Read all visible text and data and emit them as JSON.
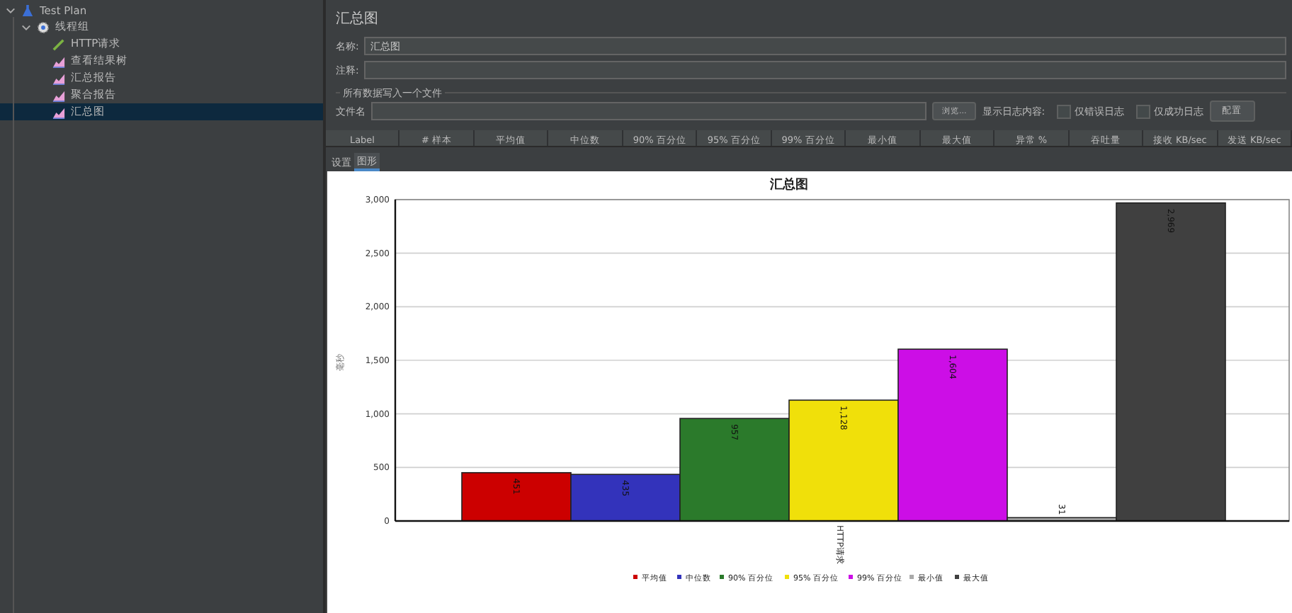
{
  "tree": [
    {
      "label": "Test Plan",
      "kind": "plan",
      "expanded": true,
      "selected": false,
      "children": [
        {
          "label": "线程组",
          "kind": "threads",
          "expanded": true,
          "selected": false,
          "children": [
            {
              "label": "HTTP请求",
              "kind": "sampler",
              "selected": false
            },
            {
              "label": "查看结果树",
              "kind": "listener",
              "selected": false
            },
            {
              "label": "汇总报告",
              "kind": "listener",
              "selected": false
            },
            {
              "label": "聚合报告",
              "kind": "listener",
              "selected": false
            },
            {
              "label": "汇总图",
              "kind": "listener",
              "selected": true
            }
          ]
        }
      ]
    }
  ],
  "panel": {
    "title": "汇总图",
    "name_field": {
      "label": "名称:",
      "value": "汇总图"
    },
    "comment_field": {
      "label": "注释:"
    },
    "file_group": {
      "title": "所有数据写入一个文件",
      "file_label": "文件名",
      "browse_button": "浏览...",
      "log_label": "显示日志内容:",
      "checkboxes": [
        {
          "label": "仅错误日志",
          "checked": false
        },
        {
          "label": "仅成功日志",
          "checked": false
        }
      ],
      "config_button": "配置"
    },
    "table": {
      "columns": [
        "Label",
        "# 样本",
        "平均值",
        "中位数",
        "90% 百分位",
        "95% 百分位",
        "99% 百分位",
        "最小值",
        "最大值",
        "异常 %",
        "吞吐量",
        "接收 KB/sec",
        "发送 KB/sec"
      ]
    },
    "tabs": [
      {
        "label": "设置",
        "selected": false
      },
      {
        "label": "图形",
        "selected": true
      }
    ],
    "chart_data": {
      "type": "bar",
      "title": "汇总图",
      "ylabel": "毫秒",
      "categories": [
        "HTTP请求"
      ],
      "series": [
        {
          "name": "平均值",
          "color": "#cc0000",
          "values": [
            451
          ]
        },
        {
          "name": "中位数",
          "color": "#3333bb",
          "values": [
            435
          ]
        },
        {
          "name": "90% 百分位",
          "color": "#2b7a2b",
          "values": [
            957
          ]
        },
        {
          "name": "95% 百分位",
          "color": "#f0e00a",
          "values": [
            1128
          ]
        },
        {
          "name": "99% 百分位",
          "color": "#cc0ee6",
          "values": [
            1604
          ]
        },
        {
          "name": "最小值",
          "color": "#aaaaaa",
          "values": [
            31
          ]
        },
        {
          "name": "最大值",
          "color": "#404040",
          "values": [
            2969
          ]
        }
      ],
      "ylim": [
        0,
        3000
      ],
      "grid": true,
      "legend": true,
      "yticks": [
        {
          "value": 0,
          "label": "0"
        },
        {
          "value": 500,
          "label": "500"
        },
        {
          "value": 1000,
          "label": "1,000"
        },
        {
          "value": 1500,
          "label": "1,500"
        },
        {
          "value": 2000,
          "label": "2,000"
        },
        {
          "value": 2500,
          "label": "2,500"
        },
        {
          "value": 3000,
          "label": "3,000"
        }
      ],
      "value_labels": [
        "451",
        "435",
        "957",
        "1,128",
        "1,604",
        "31",
        "2,969"
      ]
    }
  }
}
